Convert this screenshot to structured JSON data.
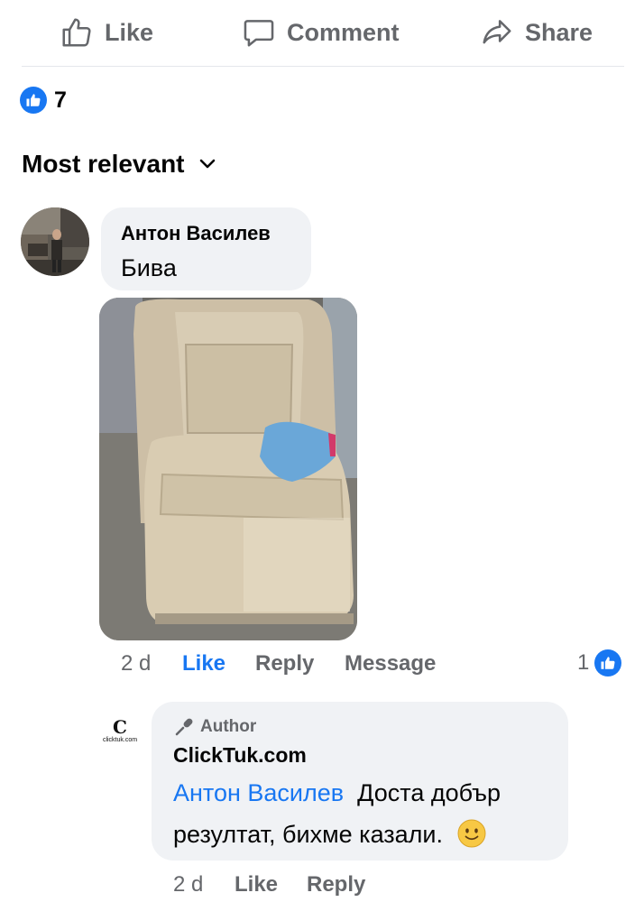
{
  "action_bar": {
    "like_label": "Like",
    "comment_label": "Comment",
    "share_label": "Share"
  },
  "reactions": {
    "count": "7",
    "icon": "like-reaction-icon"
  },
  "sort": {
    "label": "Most relevant"
  },
  "comments": [
    {
      "author": "Антон Василев",
      "text": "Бива",
      "has_photo": true,
      "time": "2 d",
      "like_label": "Like",
      "reply_label": "Reply",
      "message_label": "Message",
      "liked": true,
      "reaction_count": "1"
    }
  ],
  "reply": {
    "author_badge": "Author",
    "author": "ClickTuk.com",
    "avatar_text": "clicktuk.com",
    "mention": "Антон Василев",
    "text": "Доста добър резултат, бихме казали.",
    "emoji": "slightly-smiling-face",
    "time": "2 d",
    "like_label": "Like",
    "reply_label": "Reply"
  },
  "colors": {
    "accent": "#1877f2",
    "bubble": "#f0f2f5",
    "muted": "#65676b"
  }
}
